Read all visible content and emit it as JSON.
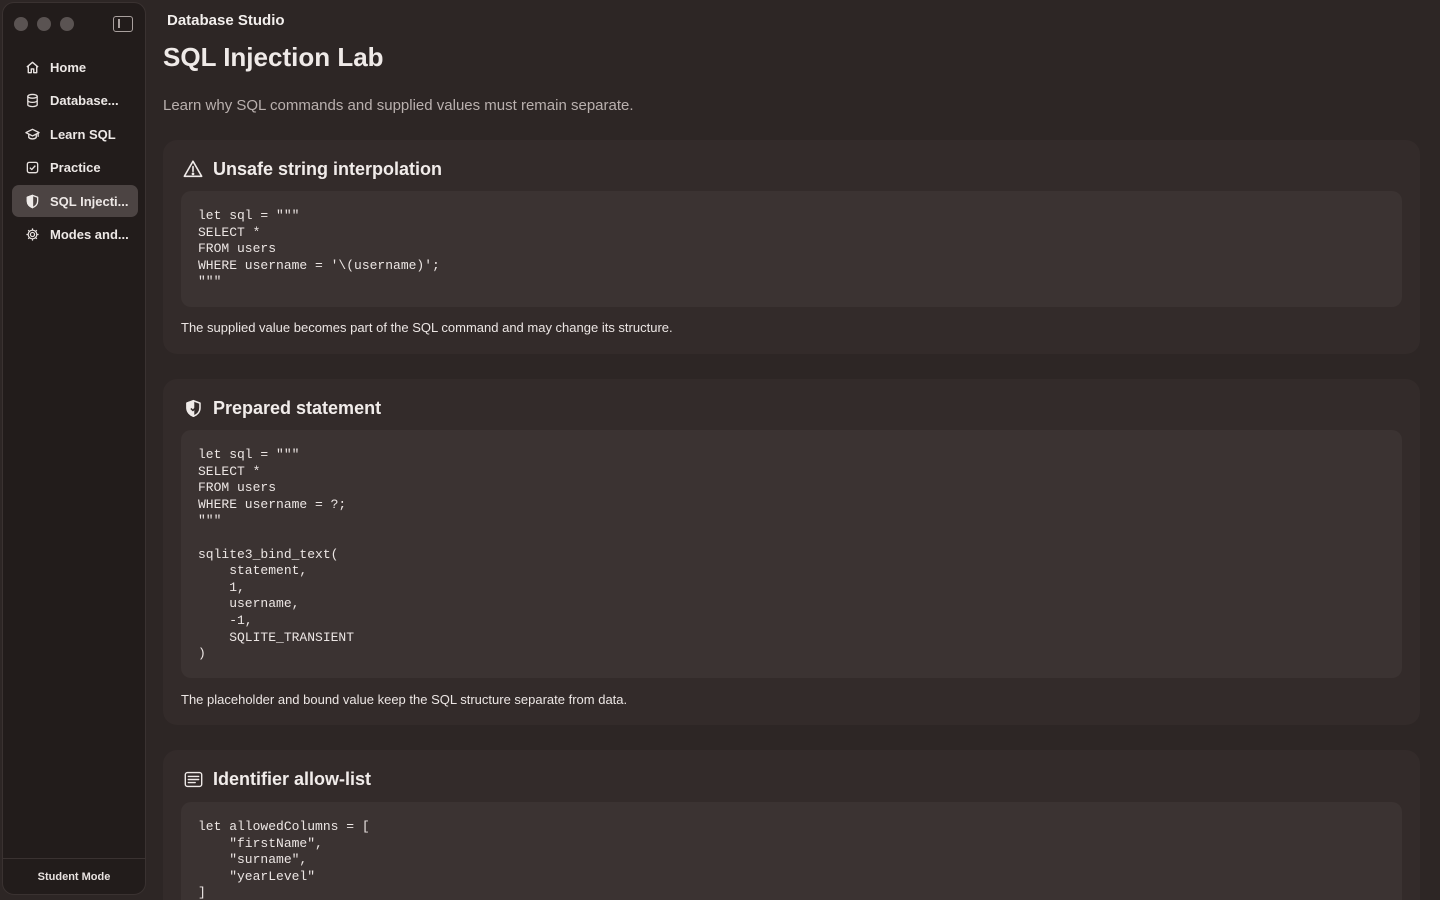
{
  "app": {
    "title": "Database Studio"
  },
  "sidebar": {
    "items": [
      {
        "label": "Home",
        "icon": "house-icon",
        "active": false
      },
      {
        "label": "Database...",
        "icon": "database-icon",
        "active": false
      },
      {
        "label": "Learn SQL",
        "icon": "graduation-cap-icon",
        "active": false
      },
      {
        "label": "Practice",
        "icon": "checkbox-icon",
        "active": false
      },
      {
        "label": "SQL Injecti...",
        "icon": "shield-icon",
        "active": true
      },
      {
        "label": "Modes and...",
        "icon": "gear-icon",
        "active": false
      }
    ],
    "footer": "Student Mode"
  },
  "page": {
    "title": "SQL Injection Lab",
    "subtitle": "Learn why SQL commands and supplied values must remain separate."
  },
  "cards": [
    {
      "title": "Unsafe string interpolation",
      "icon": "warning-triangle-icon",
      "code": "let sql = \"\"\"\nSELECT *\nFROM users\nWHERE username = '\\(username)';\n\"\"\"",
      "caption": "The supplied value becomes part of the SQL command and may change its structure."
    },
    {
      "title": "Prepared statement",
      "icon": "shield-check-icon",
      "code": "let sql = \"\"\"\nSELECT *\nFROM users\nWHERE username = ?;\n\"\"\"\n\nsqlite3_bind_text(\n    statement,\n    1,\n    username,\n    -1,\n    SQLITE_TRANSIENT\n)",
      "caption": "The placeholder and bound value keep the SQL structure separate from data."
    },
    {
      "title": "Identifier allow-list",
      "icon": "list-icon",
      "code": "let allowedColumns = [\n    \"firstName\",\n    \"surname\",\n    \"yearLevel\"\n]",
      "caption": ""
    }
  ]
}
